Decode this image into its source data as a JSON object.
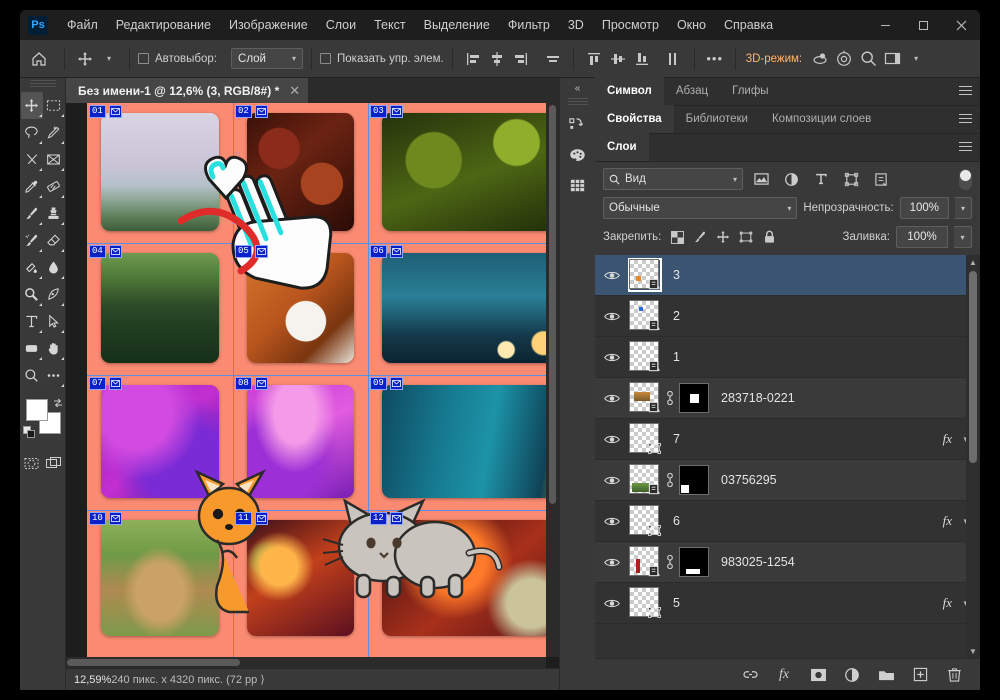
{
  "window": {
    "app_name": "Ps",
    "controls": {
      "minimize": "—",
      "maximize": "▢",
      "close": "✕"
    }
  },
  "menubar": {
    "items": [
      "Файл",
      "Редактирование",
      "Изображение",
      "Слои",
      "Текст",
      "Выделение",
      "Фильтр",
      "3D",
      "Просмотр",
      "Окно",
      "Справка"
    ]
  },
  "options_bar": {
    "home_icon": "home-icon",
    "tool_icon": "move-tool-icon",
    "autoselect_label": "Автовыбор:",
    "autoselect_value": "Слой",
    "show_controls_label": "Показать упр. элем.",
    "align_left": "align-left-icon",
    "align_center_h": "align-center-horizontal-icon",
    "align_right": "align-right-icon",
    "distribute_h": "distribute-horizontal-icon",
    "align_top": "align-top-icon",
    "align_middle_v": "align-middle-vertical-icon",
    "align_bottom": "align-bottom-icon",
    "distribute_v": "distribute-vertical-icon",
    "more": "•••",
    "mode_3d_label": "3D-режим:",
    "search_icon": "search-icon",
    "workspace_icon": "workspace-icon"
  },
  "toolbar": {
    "tools": [
      {
        "name": "move-tool",
        "selected": true
      },
      {
        "name": "rectangular-marquee-tool",
        "selected": false
      },
      {
        "name": "lasso-tool",
        "selected": false
      },
      {
        "name": "quick-selection-tool",
        "selected": false
      },
      {
        "name": "crop-tool",
        "selected": false
      },
      {
        "name": "frame-tool",
        "selected": false
      },
      {
        "name": "eyedropper-tool",
        "selected": false
      },
      {
        "name": "healing-brush-tool",
        "selected": false
      },
      {
        "name": "brush-tool",
        "selected": false
      },
      {
        "name": "clone-stamp-tool",
        "selected": false
      },
      {
        "name": "history-brush-tool",
        "selected": false
      },
      {
        "name": "eraser-tool",
        "selected": false
      },
      {
        "name": "gradient-tool",
        "selected": false
      },
      {
        "name": "blur-tool",
        "selected": false
      },
      {
        "name": "dodge-tool",
        "selected": false
      },
      {
        "name": "pen-tool",
        "selected": false
      },
      {
        "name": "type-tool",
        "selected": false
      },
      {
        "name": "path-selection-tool",
        "selected": false
      },
      {
        "name": "rectangle-tool",
        "selected": false
      },
      {
        "name": "hand-tool",
        "selected": false
      },
      {
        "name": "zoom-tool",
        "selected": false
      },
      {
        "name": "edit-toolbar-tool",
        "selected": false
      }
    ],
    "foreground_color": "#ffffff",
    "background_color": "#ffffff",
    "quick_mask": "quick-mask-icon",
    "screen_mode": "screen-mode-icon"
  },
  "document": {
    "tab_title": "Без имени-1 @ 12,6% (3, RGB/8#) *",
    "close_icon": "✕"
  },
  "status_bar": {
    "zoom": "12,59%",
    "dimensions": "240 пикс. x 4320 пикс. (72 pp ⟩"
  },
  "canvas": {
    "background_color": "#fa8a72",
    "guide_color": "#5b8fe6",
    "slices": [
      {
        "id": "01",
        "icon": "slice-image-icon"
      },
      {
        "id": "02",
        "icon": "slice-image-icon"
      },
      {
        "id": "03",
        "icon": "slice-image-icon"
      },
      {
        "id": "04",
        "icon": "slice-image-icon"
      },
      {
        "id": "05",
        "icon": "slice-image-icon"
      },
      {
        "id": "06",
        "icon": "slice-image-icon"
      },
      {
        "id": "07",
        "icon": "slice-image-icon"
      },
      {
        "id": "08",
        "icon": "slice-image-icon"
      },
      {
        "id": "09",
        "icon": "slice-image-icon"
      },
      {
        "id": "10",
        "icon": "slice-image-icon"
      },
      {
        "id": "11",
        "icon": "slice-image-icon"
      },
      {
        "id": "12",
        "icon": "slice-image-icon"
      }
    ]
  },
  "dock_rail": {
    "collapse_icon": "«",
    "buttons": [
      "history-icon",
      "color-palette-icon",
      "swatches-grid-icon"
    ]
  },
  "panel_groups": [
    {
      "tabs": [
        {
          "label": "Символ",
          "active": true
        },
        {
          "label": "Абзац",
          "active": false
        },
        {
          "label": "Глифы",
          "active": false
        }
      ],
      "menu_icon": "panel-menu-icon"
    },
    {
      "tabs": [
        {
          "label": "Свойства",
          "active": true
        },
        {
          "label": "Библиотеки",
          "active": false
        },
        {
          "label": "Композиции слоев",
          "active": false
        }
      ],
      "menu_icon": "panel-menu-icon"
    },
    {
      "tabs": [
        {
          "label": "Слои",
          "active": true
        }
      ],
      "menu_icon": "panel-menu-icon"
    }
  ],
  "layers_panel": {
    "filter": {
      "search_icon": "search-icon",
      "value": "Вид",
      "type_filters": [
        "pixel-filter-icon",
        "adjustment-filter-icon",
        "type-filter-icon",
        "shape-filter-icon",
        "smartobject-filter-icon"
      ],
      "toggle": "filter-toggle"
    },
    "blend_mode": "Обычные",
    "opacity_label": "Непрозрачность:",
    "opacity_value": "100%",
    "lock_label": "Закрепить:",
    "lock_icons": [
      "lock-transparent-pixels-icon",
      "lock-image-pixels-icon",
      "lock-position-icon",
      "lock-artboard-nesting-icon",
      "lock-all-icon"
    ],
    "fill_label": "Заливка:",
    "fill_value": "100%",
    "rows": [
      {
        "name": "3",
        "selected": true,
        "visible": true,
        "badge": "smart-object-badge",
        "has_mask": false,
        "has_fx": false,
        "thumb_art": "orange-dot"
      },
      {
        "name": "2",
        "selected": false,
        "visible": true,
        "badge": "smart-object-badge",
        "has_mask": false,
        "has_fx": false,
        "thumb_art": "blue-dot"
      },
      {
        "name": "1",
        "selected": false,
        "visible": true,
        "badge": "smart-object-badge",
        "has_mask": false,
        "has_fx": false,
        "thumb_art": "none"
      },
      {
        "name": "283718-0221",
        "selected": false,
        "visible": true,
        "badge": "smart-object-badge",
        "has_mask": true,
        "mask_shape": "center-square",
        "has_fx": false,
        "thumb_art": "fox-photo"
      },
      {
        "name": "7",
        "selected": false,
        "visible": true,
        "badge": "transform-badge",
        "has_mask": false,
        "has_fx": true,
        "thumb_art": "none"
      },
      {
        "name": "03756295",
        "selected": false,
        "visible": true,
        "badge": "smart-object-badge",
        "has_mask": true,
        "mask_shape": "bottom-left-square",
        "has_fx": false,
        "thumb_art": "grass-photo"
      },
      {
        "name": "6",
        "selected": false,
        "visible": true,
        "badge": "transform-badge",
        "has_mask": false,
        "has_fx": true,
        "thumb_art": "none"
      },
      {
        "name": "983025-1254",
        "selected": false,
        "visible": true,
        "badge": "smart-object-badge",
        "has_mask": true,
        "mask_shape": "bottom-bar",
        "has_fx": false,
        "thumb_art": "red-streak"
      },
      {
        "name": "5",
        "selected": false,
        "visible": true,
        "badge": "transform-badge",
        "has_mask": false,
        "has_fx": true,
        "thumb_art": "none"
      }
    ],
    "fx_label": "fx",
    "footer_buttons": [
      "link-layers-icon",
      "add-layer-style-icon",
      "add-layer-mask-icon",
      "new-adjustment-layer-icon",
      "new-group-icon",
      "new-layer-icon",
      "delete-layer-icon"
    ]
  }
}
